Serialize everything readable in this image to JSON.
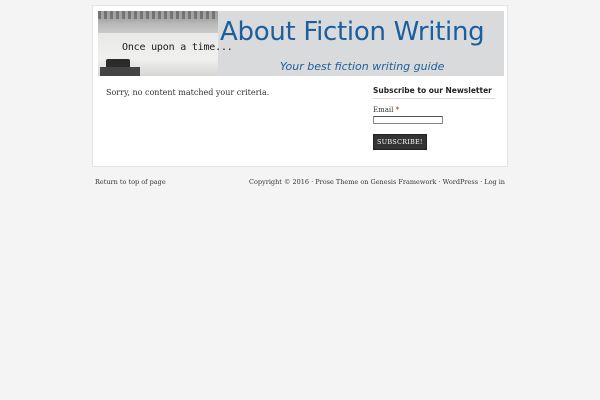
{
  "header": {
    "banner_typed_text": "Once upon a time...",
    "title": "About Fiction Writing",
    "tagline": "Your best fiction writing guide"
  },
  "content": {
    "message": "Sorry, no content matched your criteria."
  },
  "sidebar": {
    "widget_title": "Subscribe to our Newsletter",
    "email_label": "Email",
    "required_mark": "*",
    "email_value": "",
    "subscribe_label": "SUBSCRIBE!"
  },
  "footer": {
    "back_to_top": "Return to top of page",
    "copyright": "Copyright © 2016 · ",
    "prose_theme": "Prose Theme",
    "on": " on ",
    "genesis": "Genesis Framework",
    "sep1": " · ",
    "wordpress": "WordPress",
    "sep2": " · ",
    "login": "Log in"
  },
  "colors": {
    "page_bg": "#f4f4f4",
    "title_blue": "#1c5f9e",
    "button_bg": "#333333"
  }
}
